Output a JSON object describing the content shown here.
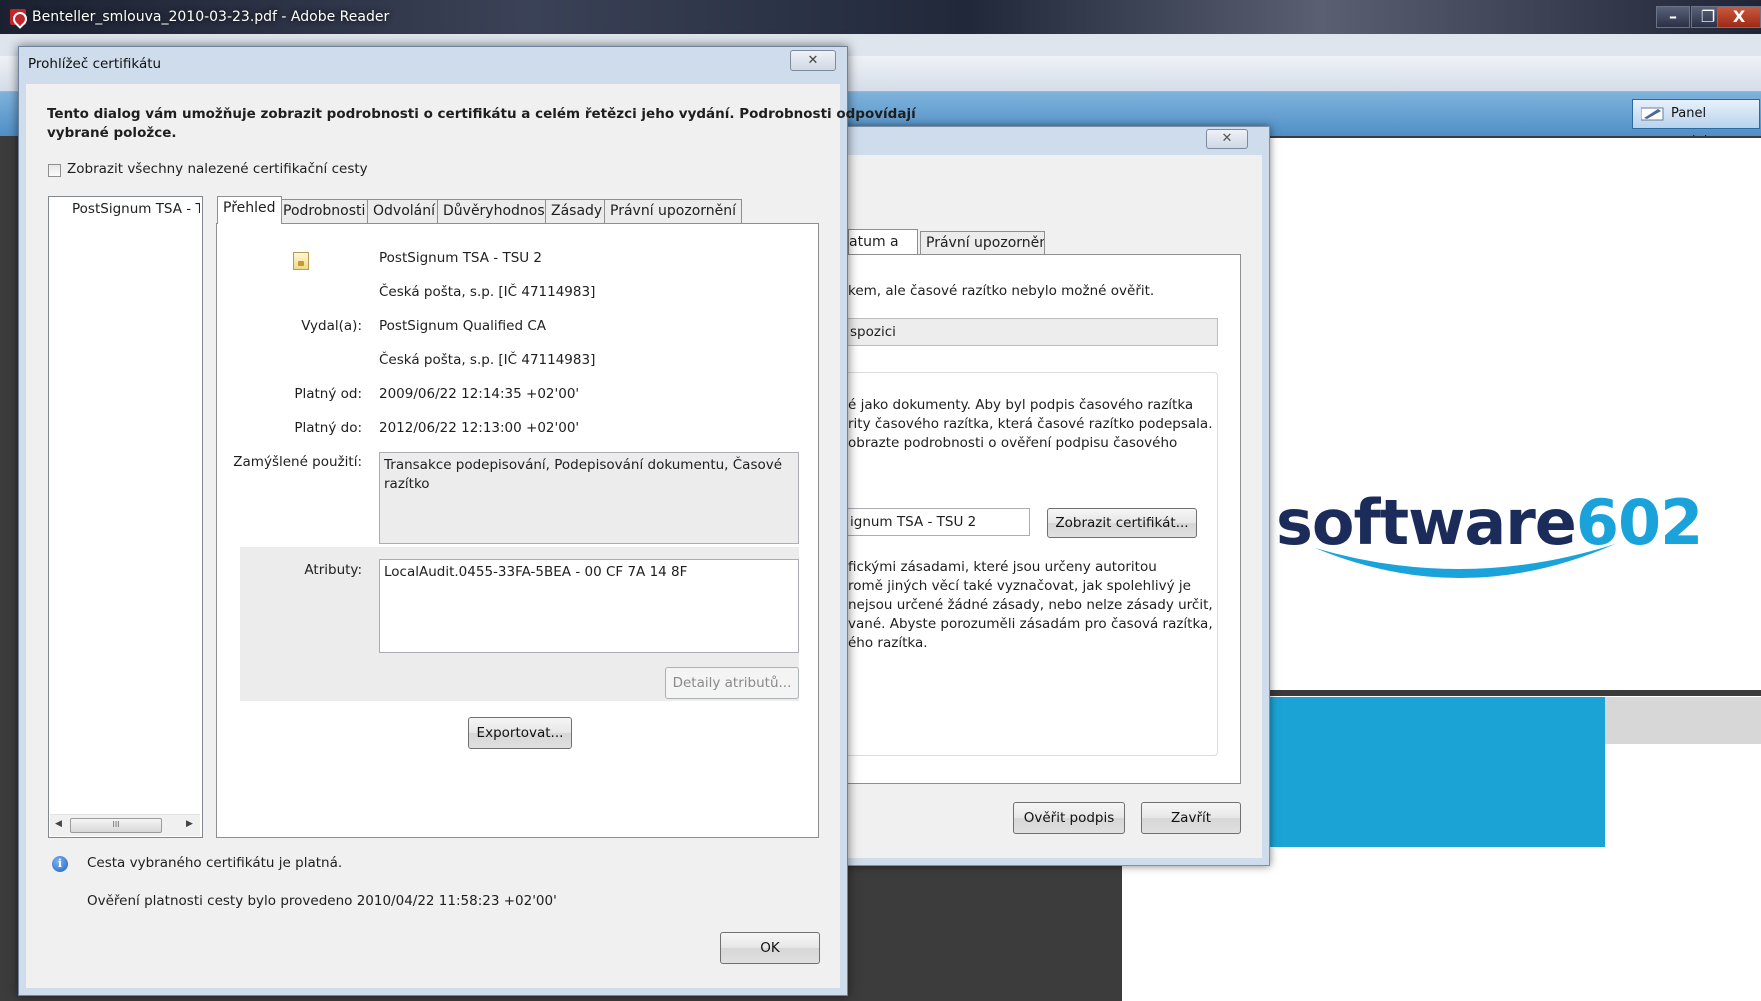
{
  "app": {
    "title": "Benteller_smlouva_2010-03-23.pdf - Adobe Reader",
    "panel_button": "Panel podpisu",
    "window_buttons": {
      "minimize": "–",
      "maximize": "❐",
      "close": "X"
    }
  },
  "document": {
    "logo_text": "software",
    "logo_number": "602",
    "colors": {
      "logo_dark": "#1c2c5a",
      "logo_accent": "#1aa3da",
      "block_blue": "#1ca3d6"
    }
  },
  "signature_dialog": {
    "close_symbol": "✕",
    "tabs": [
      "atum a čas",
      "Právní upozornění"
    ],
    "status_line": "kem, ale časové razítko nebylo možné ověřit.",
    "field_value": "spozici",
    "paragraph1": [
      "é jako dokumenty. Aby byl podpis časového razítka",
      "rity časového razítka, která časové razítko podepsala.",
      "obrazte podrobnosti o ověření podpisu časového"
    ],
    "signer_field": "ignum TSA - TSU 2",
    "show_cert_button": "Zobrazit certifikát...",
    "paragraph2": [
      "fickými zásadami, které jsou určeny autoritou",
      "romě jiných věcí také vyznačovat, jak spolehlivý je",
      "nejsou určené žádné zásady, nebo nelze zásady určit,",
      "vané. Abyste porozuměli zásadám pro časová razítka,",
      "ého razítka."
    ],
    "verify_button": "Ověřit podpis",
    "close_button": "Zavřít"
  },
  "cert_dialog": {
    "title": "Prohlížeč certifikátu",
    "close_symbol": "✕",
    "heading_line1": "Tento dialog vám umožňuje zobrazit podrobnosti o certifikátu a celém řetězci jeho vydání. Podrobnosti odpovídají",
    "heading_line2": "vybrané položce.",
    "show_all_paths": "Zobrazit všechny nalezené certifikační cesty",
    "tree_item": "PostSignum TSA - TSU 2",
    "scroll_mid": "III",
    "tabs": [
      "Přehled",
      "Podrobnosti",
      "Odvolání",
      "Důvěryhodnost",
      "Zásady",
      "Právní upozornění"
    ],
    "overview": {
      "subject_name": "PostSignum TSA - TSU 2",
      "subject_org": "Česká pošta, s.p. [IČ 47114983]",
      "issued_by_label": "Vydal(a):",
      "issuer_name": "PostSignum Qualified CA",
      "issuer_org": "Česká pošta, s.p. [IČ 47114983]",
      "valid_from_label": "Platný od:",
      "valid_from": "2009/06/22 12:14:35 +02'00'",
      "valid_to_label": "Platný do:",
      "valid_to": "2012/06/22 12:13:00 +02'00'",
      "usage_label": "Zamýšlené použití:",
      "usage_value": "Transakce podepisování, Podepisování dokumentu, Časové razítko",
      "attributes_label": "Atributy:",
      "attributes_value": "LocalAudit.0455-33FA-5BEA - 00 CF 7A 14 8F",
      "attr_details_button": "Detaily atributů...",
      "export_button": "Exportovat..."
    },
    "status_valid": "Cesta vybraného certifikátu je platná.",
    "status_checked": "Ověření platnosti cesty bylo provedeno 2010/04/22 11:58:23 +02'00'",
    "ok_button": "OK"
  }
}
